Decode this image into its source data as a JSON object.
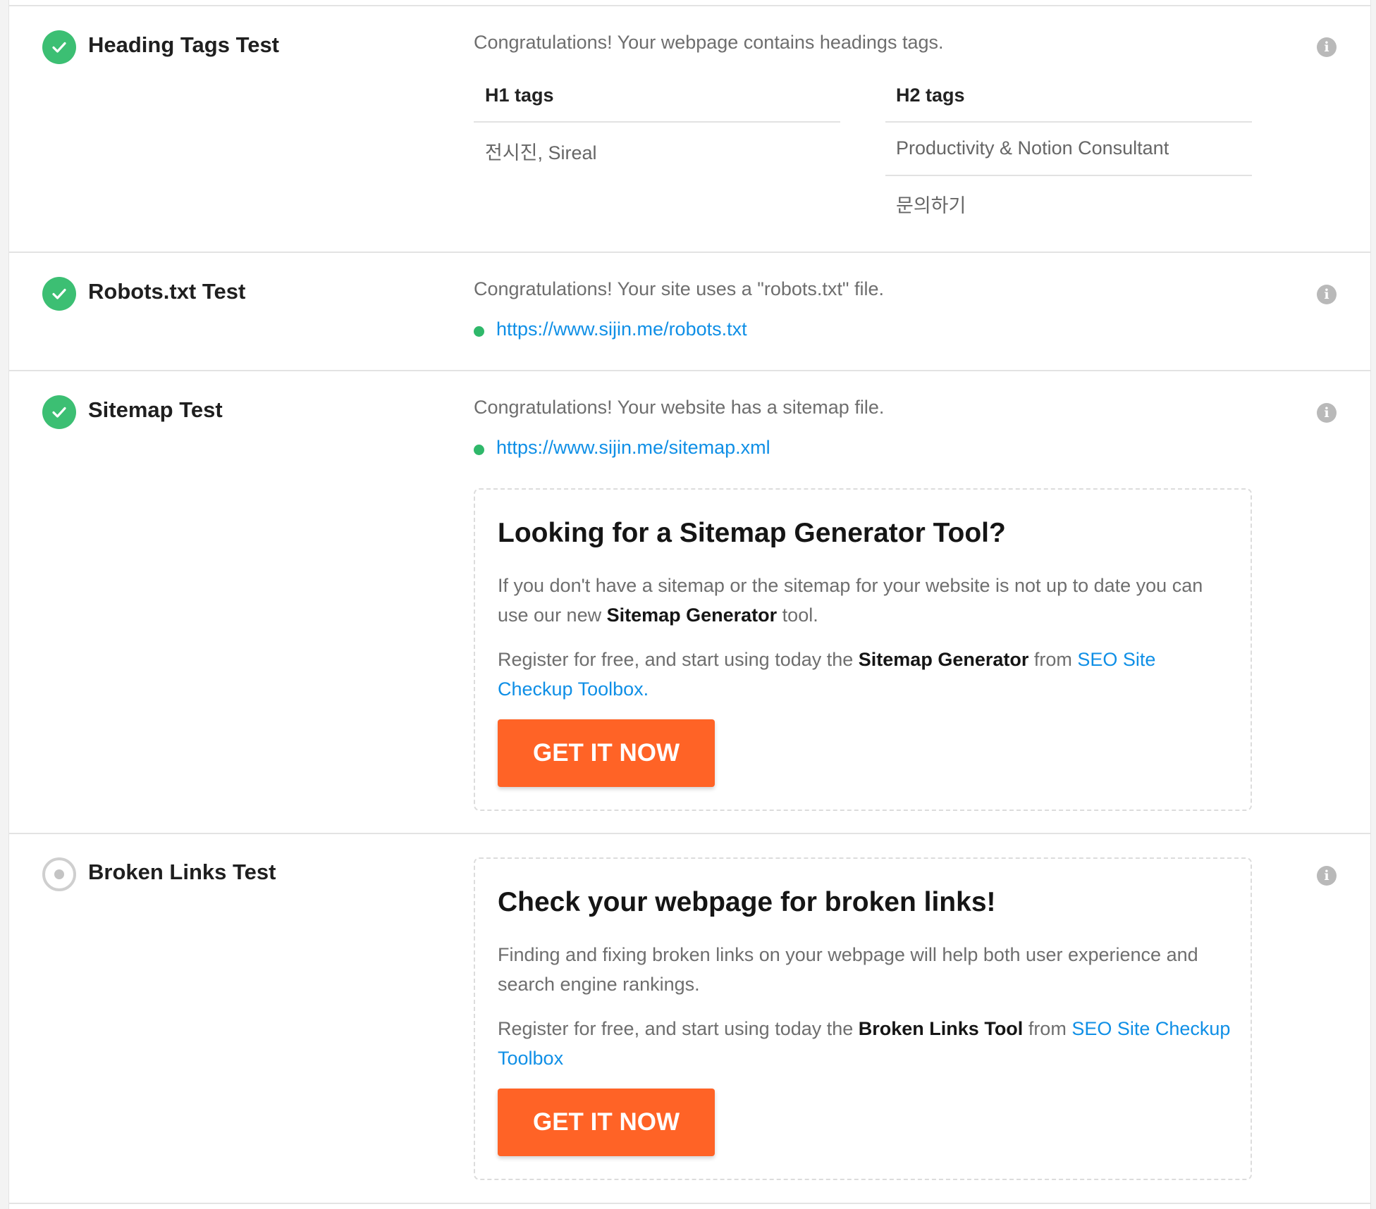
{
  "tests": {
    "heading": {
      "title": "Heading Tags Test",
      "message": "Congratulations! Your webpage contains headings tags.",
      "h1_header": "H1 tags",
      "h1_values": [
        "전시진, Sireal"
      ],
      "h2_header": "H2 tags",
      "h2_values": [
        "Productivity & Notion Consultant",
        "문의하기"
      ]
    },
    "robots": {
      "title": "Robots.txt Test",
      "message": "Congratulations! Your site uses a \"robots.txt\" file.",
      "link": "https://www.sijin.me/robots.txt"
    },
    "sitemap": {
      "title": "Sitemap Test",
      "message": "Congratulations! Your website has a sitemap file.",
      "link": "https://www.sijin.me/sitemap.xml",
      "promo": {
        "title": "Looking for a Sitemap Generator Tool?",
        "p1_a": "If you don't have a sitemap or the sitemap for your website is not up to date you can use our new ",
        "p1_b": "Sitemap Generator",
        "p1_c": " tool.",
        "p2_a": "Register for free, and start using today the ",
        "p2_b": "Sitemap Generator",
        "p2_c": " from ",
        "p2_link": "SEO Site Checkup Toolbox.",
        "cta": "GET IT NOW"
      }
    },
    "broken": {
      "title": "Broken Links Test",
      "promo": {
        "title": "Check your webpage for broken links!",
        "p1": "Finding and fixing broken links on your webpage will help both user experience and search engine rankings.",
        "p2_a": "Register for free, and start using today the ",
        "p2_b": "Broken Links Tool",
        "p2_c": " from ",
        "p2_link": "SEO Site Checkup Toolbox",
        "cta": "GET IT NOW"
      }
    }
  },
  "colors": {
    "pass": "#3cbf73",
    "link": "#0f8fe6",
    "cta": "#ff6326",
    "info_icon": "#b9b9b9"
  },
  "icons": {
    "pass": "check-circle-icon",
    "neutral": "radio-circle-icon",
    "info": "info-icon",
    "bullet": "bullet-dot-icon"
  }
}
